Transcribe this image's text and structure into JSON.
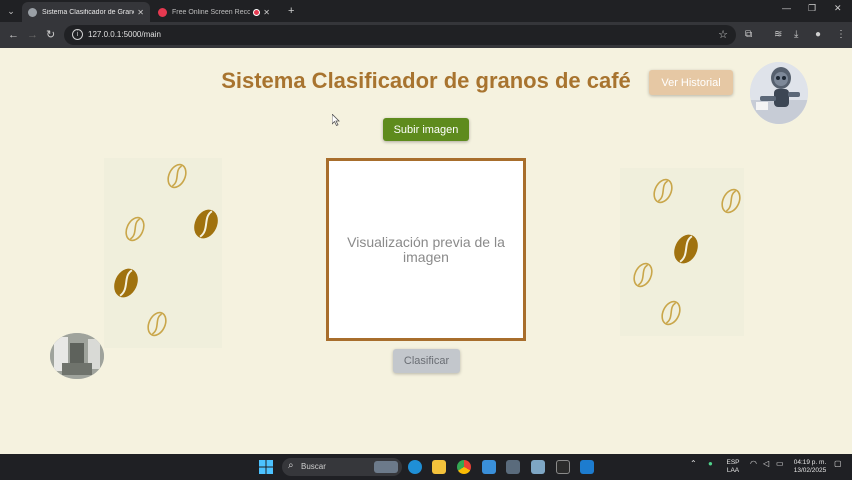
{
  "browser": {
    "tabs": [
      {
        "title": "Sistema Clasificador de Granos",
        "active": true
      },
      {
        "title": "Free Online Screen Recorder",
        "active": false
      }
    ],
    "url": "127.0.0.1:5000/main"
  },
  "page": {
    "title": "Sistema Clasificador de granos de café",
    "history_button": "Ver Historial",
    "upload_button": "Subir imagen",
    "preview_text": "Visualización previa de la imagen",
    "classify_button": "Clasificar"
  },
  "taskbar": {
    "search_placeholder": "Buscar",
    "language": "ESP",
    "layout": "LAA",
    "time": "04:19 p. m.",
    "date": "13/02/2025"
  },
  "colors": {
    "page_background": "#f5f2df",
    "title": "#a8742f",
    "history_button": "#e6c8a4",
    "upload_button": "#5e8b1d",
    "preview_border": "#a86e2c",
    "classify_button": "#c3c7cc",
    "bean_filled": "#a0720f",
    "bean_outline": "#c9a64a"
  },
  "icons": {
    "tab_menu": "chevron-down-icon",
    "back": "arrow-left-icon",
    "forward": "arrow-right-icon",
    "reload": "reload-icon",
    "site_info": "info-icon",
    "bookmark": "star-icon",
    "extensions": "puzzle-icon",
    "downloads": "download-icon",
    "profile": "person-icon",
    "menu": "kebab-icon",
    "start": "windows-icon",
    "search": "search-icon"
  }
}
